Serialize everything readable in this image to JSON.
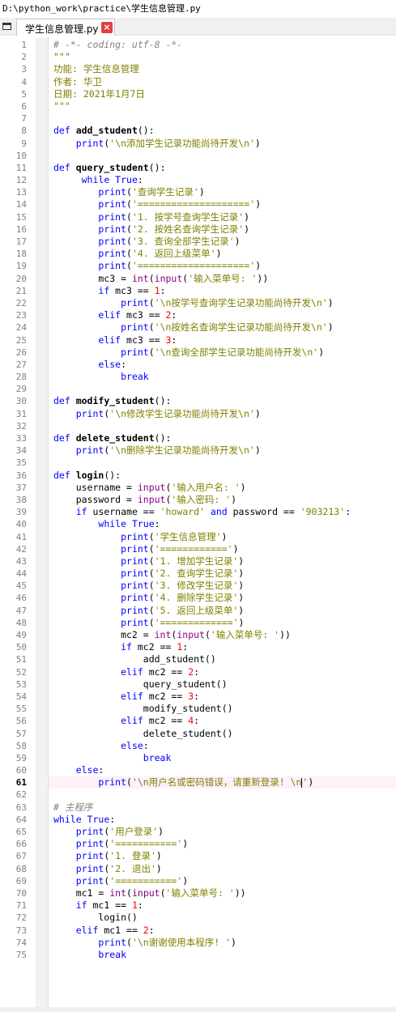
{
  "window": {
    "path": "D:\\python_work\\practice\\学生信息管理.py"
  },
  "tab": {
    "label": "学生信息管理.py",
    "close": "×"
  },
  "editor": {
    "current_line": 61,
    "lines": [
      [
        [
          "cm",
          "# -*- coding: utf-8 -*-"
        ]
      ],
      [
        [
          "str",
          "\"\"\""
        ]
      ],
      [
        [
          "str",
          "功能: 学生信息管理"
        ]
      ],
      [
        [
          "str",
          "作者: 华卫"
        ]
      ],
      [
        [
          "str",
          "日期: 2021年1月7日"
        ]
      ],
      [
        [
          "str",
          "\"\"\""
        ]
      ],
      [],
      [
        [
          "kw",
          "def "
        ],
        [
          "fn",
          "add_student"
        ],
        [
          "op",
          "():"
        ]
      ],
      [
        [
          "op",
          "    "
        ],
        [
          "kw",
          "print"
        ],
        [
          "op",
          "("
        ],
        [
          "str",
          "'\\n添加学生记录功能尚待开发\\n'"
        ],
        [
          "op",
          ")"
        ]
      ],
      [],
      [
        [
          "kw",
          "def "
        ],
        [
          "fn",
          "query_student"
        ],
        [
          "op",
          "():"
        ]
      ],
      [
        [
          "op",
          "     "
        ],
        [
          "kw",
          "while "
        ],
        [
          "kw",
          "True"
        ],
        [
          "op",
          ":"
        ]
      ],
      [
        [
          "op",
          "        "
        ],
        [
          "kw",
          "print"
        ],
        [
          "op",
          "("
        ],
        [
          "str",
          "'查询学生记录'"
        ],
        [
          "op",
          ")"
        ]
      ],
      [
        [
          "op",
          "        "
        ],
        [
          "kw",
          "print"
        ],
        [
          "op",
          "("
        ],
        [
          "str",
          "'===================='"
        ],
        [
          "op",
          ")"
        ]
      ],
      [
        [
          "op",
          "        "
        ],
        [
          "kw",
          "print"
        ],
        [
          "op",
          "("
        ],
        [
          "str",
          "'1. 按学号查询学生记录'"
        ],
        [
          "op",
          ")"
        ]
      ],
      [
        [
          "op",
          "        "
        ],
        [
          "kw",
          "print"
        ],
        [
          "op",
          "("
        ],
        [
          "str",
          "'2. 按姓名查询学生记录'"
        ],
        [
          "op",
          ")"
        ]
      ],
      [
        [
          "op",
          "        "
        ],
        [
          "kw",
          "print"
        ],
        [
          "op",
          "("
        ],
        [
          "str",
          "'3. 查询全部学生记录'"
        ],
        [
          "op",
          ")"
        ]
      ],
      [
        [
          "op",
          "        "
        ],
        [
          "kw",
          "print"
        ],
        [
          "op",
          "("
        ],
        [
          "str",
          "'4. 返回上级菜单'"
        ],
        [
          "op",
          ")"
        ]
      ],
      [
        [
          "op",
          "        "
        ],
        [
          "kw",
          "print"
        ],
        [
          "op",
          "("
        ],
        [
          "str",
          "'===================='"
        ],
        [
          "op",
          ")"
        ]
      ],
      [
        [
          "op",
          "        mc3 = "
        ],
        [
          "bi",
          "int"
        ],
        [
          "op",
          "("
        ],
        [
          "bi",
          "input"
        ],
        [
          "op",
          "("
        ],
        [
          "str",
          "'输入菜单号: '"
        ],
        [
          "op",
          "))"
        ]
      ],
      [
        [
          "op",
          "        "
        ],
        [
          "kw",
          "if "
        ],
        [
          "op",
          "mc3 == "
        ],
        [
          "num",
          "1"
        ],
        [
          "op",
          ":"
        ]
      ],
      [
        [
          "op",
          "            "
        ],
        [
          "kw",
          "print"
        ],
        [
          "op",
          "("
        ],
        [
          "str",
          "'\\n按学号查询学生记录功能尚待开发\\n'"
        ],
        [
          "op",
          ")"
        ]
      ],
      [
        [
          "op",
          "        "
        ],
        [
          "kw",
          "elif "
        ],
        [
          "op",
          "mc3 == "
        ],
        [
          "num",
          "2"
        ],
        [
          "op",
          ":"
        ]
      ],
      [
        [
          "op",
          "            "
        ],
        [
          "kw",
          "print"
        ],
        [
          "op",
          "("
        ],
        [
          "str",
          "'\\n按姓名查询学生记录功能尚待开发\\n'"
        ],
        [
          "op",
          ")"
        ]
      ],
      [
        [
          "op",
          "        "
        ],
        [
          "kw",
          "elif "
        ],
        [
          "op",
          "mc3 == "
        ],
        [
          "num",
          "3"
        ],
        [
          "op",
          ":"
        ]
      ],
      [
        [
          "op",
          "            "
        ],
        [
          "kw",
          "print"
        ],
        [
          "op",
          "("
        ],
        [
          "str",
          "'\\n查询全部学生记录功能尚待开发\\n'"
        ],
        [
          "op",
          ")"
        ]
      ],
      [
        [
          "op",
          "        "
        ],
        [
          "kw",
          "else"
        ],
        [
          "op",
          ":"
        ]
      ],
      [
        [
          "op",
          "            "
        ],
        [
          "kw",
          "break"
        ]
      ],
      [],
      [
        [
          "kw",
          "def "
        ],
        [
          "fn",
          "modify_student"
        ],
        [
          "op",
          "():"
        ]
      ],
      [
        [
          "op",
          "    "
        ],
        [
          "kw",
          "print"
        ],
        [
          "op",
          "("
        ],
        [
          "str",
          "'\\n修改学生记录功能尚待开发\\n'"
        ],
        [
          "op",
          ")"
        ]
      ],
      [],
      [
        [
          "kw",
          "def "
        ],
        [
          "fn",
          "delete_student"
        ],
        [
          "op",
          "():"
        ]
      ],
      [
        [
          "op",
          "    "
        ],
        [
          "kw",
          "print"
        ],
        [
          "op",
          "("
        ],
        [
          "str",
          "'\\n删除学生记录功能尚待开发\\n'"
        ],
        [
          "op",
          ")"
        ]
      ],
      [],
      [
        [
          "kw",
          "def "
        ],
        [
          "fn",
          "login"
        ],
        [
          "op",
          "():"
        ]
      ],
      [
        [
          "op",
          "    username = "
        ],
        [
          "bi",
          "input"
        ],
        [
          "op",
          "("
        ],
        [
          "str",
          "'输入用户名: '"
        ],
        [
          "op",
          ")"
        ]
      ],
      [
        [
          "op",
          "    password = "
        ],
        [
          "bi",
          "input"
        ],
        [
          "op",
          "("
        ],
        [
          "str",
          "'输入密码: '"
        ],
        [
          "op",
          ")"
        ]
      ],
      [
        [
          "op",
          "    "
        ],
        [
          "kw",
          "if "
        ],
        [
          "op",
          "username == "
        ],
        [
          "str",
          "'howard'"
        ],
        [
          "op",
          " "
        ],
        [
          "kw",
          "and"
        ],
        [
          "op",
          " password == "
        ],
        [
          "str",
          "'903213'"
        ],
        [
          "op",
          ":"
        ]
      ],
      [
        [
          "op",
          "        "
        ],
        [
          "kw",
          "while "
        ],
        [
          "kw",
          "True"
        ],
        [
          "op",
          ":"
        ]
      ],
      [
        [
          "op",
          "            "
        ],
        [
          "kw",
          "print"
        ],
        [
          "op",
          "("
        ],
        [
          "str",
          "'学生信息管理'"
        ],
        [
          "op",
          ")"
        ]
      ],
      [
        [
          "op",
          "            "
        ],
        [
          "kw",
          "print"
        ],
        [
          "op",
          "("
        ],
        [
          "str",
          "'============'"
        ],
        [
          "op",
          ")"
        ]
      ],
      [
        [
          "op",
          "            "
        ],
        [
          "kw",
          "print"
        ],
        [
          "op",
          "("
        ],
        [
          "str",
          "'1. 增加学生记录'"
        ],
        [
          "op",
          ")"
        ]
      ],
      [
        [
          "op",
          "            "
        ],
        [
          "kw",
          "print"
        ],
        [
          "op",
          "("
        ],
        [
          "str",
          "'2. 查询学生记录'"
        ],
        [
          "op",
          ")"
        ]
      ],
      [
        [
          "op",
          "            "
        ],
        [
          "kw",
          "print"
        ],
        [
          "op",
          "("
        ],
        [
          "str",
          "'3. 修改学生记录'"
        ],
        [
          "op",
          ")"
        ]
      ],
      [
        [
          "op",
          "            "
        ],
        [
          "kw",
          "print"
        ],
        [
          "op",
          "("
        ],
        [
          "str",
          "'4. 删除学生记录'"
        ],
        [
          "op",
          ")"
        ]
      ],
      [
        [
          "op",
          "            "
        ],
        [
          "kw",
          "print"
        ],
        [
          "op",
          "("
        ],
        [
          "str",
          "'5. 返回上级菜单'"
        ],
        [
          "op",
          ")"
        ]
      ],
      [
        [
          "op",
          "            "
        ],
        [
          "kw",
          "print"
        ],
        [
          "op",
          "("
        ],
        [
          "str",
          "'============='"
        ],
        [
          "op",
          ")"
        ]
      ],
      [
        [
          "op",
          "            mc2 = "
        ],
        [
          "bi",
          "int"
        ],
        [
          "op",
          "("
        ],
        [
          "bi",
          "input"
        ],
        [
          "op",
          "("
        ],
        [
          "str",
          "'输入菜单号: '"
        ],
        [
          "op",
          "))"
        ]
      ],
      [
        [
          "op",
          "            "
        ],
        [
          "kw",
          "if "
        ],
        [
          "op",
          "mc2 == "
        ],
        [
          "num",
          "1"
        ],
        [
          "op",
          ":"
        ]
      ],
      [
        [
          "op",
          "                add_student()"
        ]
      ],
      [
        [
          "op",
          "            "
        ],
        [
          "kw",
          "elif "
        ],
        [
          "op",
          "mc2 == "
        ],
        [
          "num",
          "2"
        ],
        [
          "op",
          ":"
        ]
      ],
      [
        [
          "op",
          "                query_student()"
        ]
      ],
      [
        [
          "op",
          "            "
        ],
        [
          "kw",
          "elif "
        ],
        [
          "op",
          "mc2 == "
        ],
        [
          "num",
          "3"
        ],
        [
          "op",
          ":"
        ]
      ],
      [
        [
          "op",
          "                modify_student()"
        ]
      ],
      [
        [
          "op",
          "            "
        ],
        [
          "kw",
          "elif "
        ],
        [
          "op",
          "mc2 == "
        ],
        [
          "num",
          "4"
        ],
        [
          "op",
          ":"
        ]
      ],
      [
        [
          "op",
          "                delete_student()"
        ]
      ],
      [
        [
          "op",
          "            "
        ],
        [
          "kw",
          "else"
        ],
        [
          "op",
          ":"
        ]
      ],
      [
        [
          "op",
          "                "
        ],
        [
          "kw",
          "break"
        ]
      ],
      [
        [
          "op",
          "    "
        ],
        [
          "kw",
          "else"
        ],
        [
          "op",
          ":"
        ]
      ],
      [
        [
          "op",
          "        "
        ],
        [
          "kw",
          "print"
        ],
        [
          "op",
          "("
        ],
        [
          "str",
          "'\\n用户名或密码错误，请重新登录! \\n"
        ],
        [
          "caret",
          ""
        ],
        [
          "str",
          "'"
        ],
        [
          "op",
          ")"
        ]
      ],
      [],
      [
        [
          "cm",
          "# 主程序"
        ]
      ],
      [
        [
          "kw",
          "while "
        ],
        [
          "kw",
          "True"
        ],
        [
          "op",
          ":"
        ]
      ],
      [
        [
          "op",
          "    "
        ],
        [
          "kw",
          "print"
        ],
        [
          "op",
          "("
        ],
        [
          "str",
          "'用户登录'"
        ],
        [
          "op",
          ")"
        ]
      ],
      [
        [
          "op",
          "    "
        ],
        [
          "kw",
          "print"
        ],
        [
          "op",
          "("
        ],
        [
          "str",
          "'==========='"
        ],
        [
          "op",
          ")"
        ]
      ],
      [
        [
          "op",
          "    "
        ],
        [
          "kw",
          "print"
        ],
        [
          "op",
          "("
        ],
        [
          "str",
          "'1. 登录'"
        ],
        [
          "op",
          ")"
        ]
      ],
      [
        [
          "op",
          "    "
        ],
        [
          "kw",
          "print"
        ],
        [
          "op",
          "("
        ],
        [
          "str",
          "'2. 退出'"
        ],
        [
          "op",
          ")"
        ]
      ],
      [
        [
          "op",
          "    "
        ],
        [
          "kw",
          "print"
        ],
        [
          "op",
          "("
        ],
        [
          "str",
          "'==========='"
        ],
        [
          "op",
          ")"
        ]
      ],
      [
        [
          "op",
          "    mc1 = "
        ],
        [
          "bi",
          "int"
        ],
        [
          "op",
          "("
        ],
        [
          "bi",
          "input"
        ],
        [
          "op",
          "("
        ],
        [
          "str",
          "'输入菜单号: '"
        ],
        [
          "op",
          "))"
        ]
      ],
      [
        [
          "op",
          "    "
        ],
        [
          "kw",
          "if "
        ],
        [
          "op",
          "mc1 == "
        ],
        [
          "num",
          "1"
        ],
        [
          "op",
          ":"
        ]
      ],
      [
        [
          "op",
          "        login()"
        ]
      ],
      [
        [
          "op",
          "    "
        ],
        [
          "kw",
          "elif "
        ],
        [
          "op",
          "mc1 == "
        ],
        [
          "num",
          "2"
        ],
        [
          "op",
          ":"
        ]
      ],
      [
        [
          "op",
          "        "
        ],
        [
          "kw",
          "print"
        ],
        [
          "op",
          "("
        ],
        [
          "str",
          "'\\n谢谢使用本程序! '"
        ],
        [
          "op",
          ")"
        ]
      ],
      [
        [
          "op",
          "        "
        ],
        [
          "kw",
          "break"
        ]
      ]
    ]
  }
}
